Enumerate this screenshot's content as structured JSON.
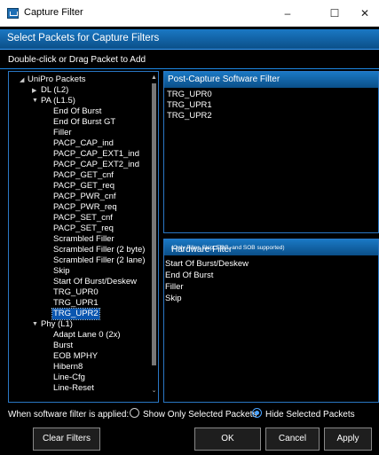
{
  "window": {
    "title": "Capture Filter",
    "minimize": "–",
    "maximize": "☐",
    "close": "✕"
  },
  "header": {
    "title": "Select Packets for Capture Filters"
  },
  "subheader": "Double-click or Drag Packet to Add",
  "tree": [
    {
      "label": "UniPro Packets",
      "expander": "◢"
    },
    {
      "label": "DL (L2)",
      "expander": "▶"
    },
    {
      "label": "PA (L1.5)",
      "expander": "▼"
    },
    {
      "label": "End Of Burst"
    },
    {
      "label": "End Of Burst GT"
    },
    {
      "label": "Filler"
    },
    {
      "label": "PACP_CAP_ind"
    },
    {
      "label": "PACP_CAP_EXT1_ind"
    },
    {
      "label": "PACP_CAP_EXT2_ind"
    },
    {
      "label": "PACP_GET_cnf"
    },
    {
      "label": "PACP_GET_req"
    },
    {
      "label": "PACP_PWR_cnf"
    },
    {
      "label": "PACP_PWR_req"
    },
    {
      "label": "PACP_SET_cnf"
    },
    {
      "label": "PACP_SET_req"
    },
    {
      "label": "Scrambled Filler"
    },
    {
      "label": "Scrambled Filler (2 byte)"
    },
    {
      "label": "Scrambled Filler (2 lane)"
    },
    {
      "label": "Skip"
    },
    {
      "label": "Start Of Burst/Deskew"
    },
    {
      "label": "TRG_UPR0"
    },
    {
      "label": "TRG_UPR1"
    },
    {
      "label": "TRG_UPR2"
    },
    {
      "label": "Phy (L1)",
      "expander": "▼"
    },
    {
      "label": "Adapt Lane 0 (2x)"
    },
    {
      "label": "Burst"
    },
    {
      "label": "EOB MPHY"
    },
    {
      "label": "Hibern8"
    },
    {
      "label": "Line-Cfg"
    },
    {
      "label": "Line-Reset"
    }
  ],
  "scroll": {
    "up": "▲",
    "down": "⌄"
  },
  "software_filter": {
    "title": "Post-Capture Software Filter",
    "items": [
      "TRG_UPR0",
      "TRG_UPR1",
      "TRG_UPR2"
    ]
  },
  "hardware_filter": {
    "title": "Hardware Filter",
    "note": "(Only Filler, Skip, EOB, and SOB supported)",
    "items": [
      "Start Of Burst/Deskew",
      "End Of Burst",
      "Filler",
      "Skip"
    ]
  },
  "filter_mode": {
    "label": "When software filter is applied:",
    "option_show": "Show Only Selected Packets",
    "option_hide": "Hide Selected Packets",
    "selected": "hide"
  },
  "buttons": {
    "clear": "Clear Filters",
    "ok": "OK",
    "cancel": "Cancel",
    "apply": "Apply"
  }
}
